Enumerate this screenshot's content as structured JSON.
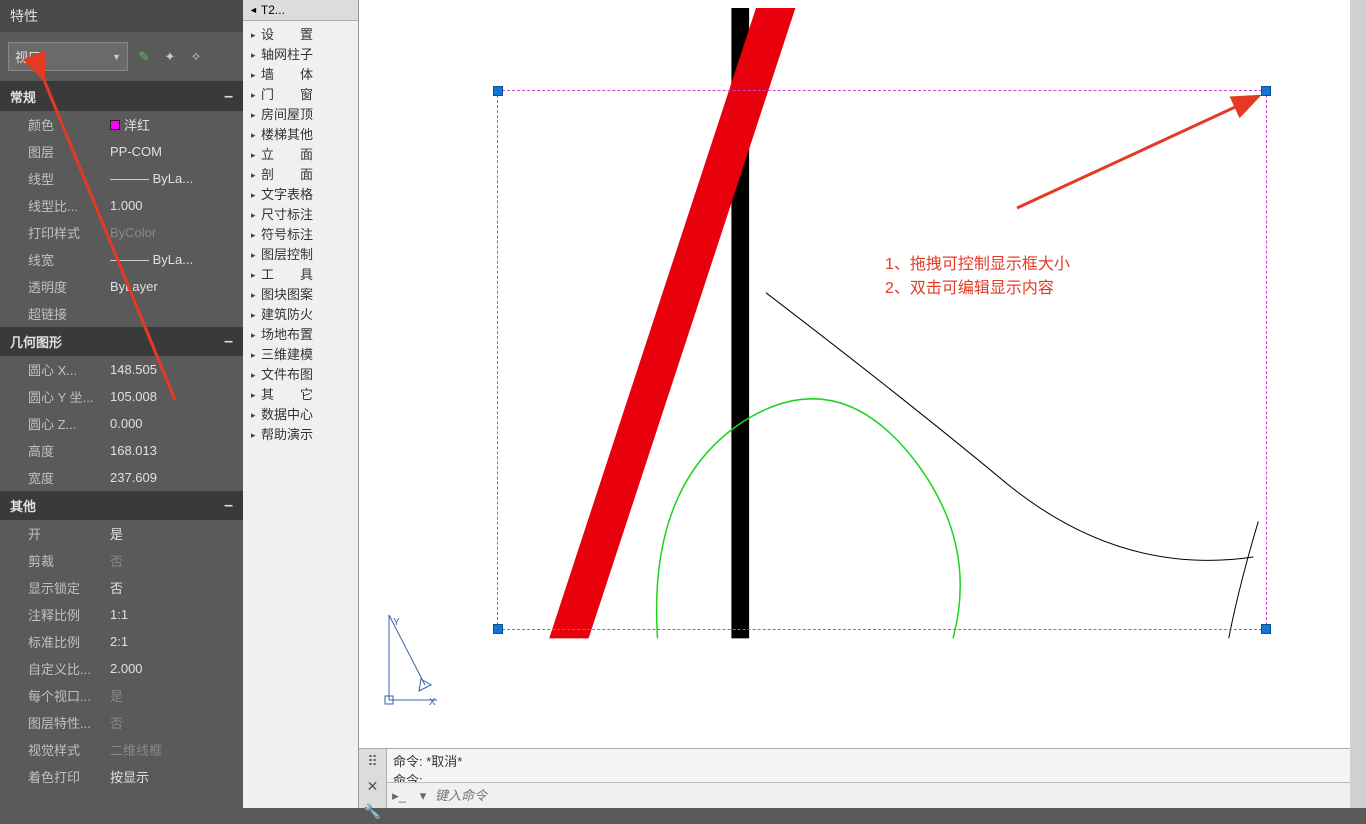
{
  "panel": {
    "title": "特性",
    "dropdown_value": "视口",
    "sections": {
      "general": {
        "title": "常规",
        "rows": {
          "color_label": "颜色",
          "color_value": "洋红",
          "layer_label": "图层",
          "layer_value": "PP-COM",
          "linetype_label": "线型",
          "linetype_value": "——— ByLa...",
          "ltscale_label": "线型比...",
          "ltscale_value": "1.000",
          "plotstyle_label": "打印样式",
          "plotstyle_value": "ByColor",
          "lineweight_label": "线宽",
          "lineweight_value": "——— ByLa...",
          "transparency_label": "透明度",
          "transparency_value": "ByLayer",
          "hyperlink_label": "超链接",
          "hyperlink_value": ""
        }
      },
      "geometry": {
        "title": "几何图形",
        "rows": {
          "cx_label": "圆心 X...",
          "cx_value": "148.505",
          "cy_label": "圆心 Y 坐...",
          "cy_value": "105.008",
          "cz_label": "圆心 Z...",
          "cz_value": "0.000",
          "h_label": "高度",
          "h_value": "168.013",
          "w_label": "宽度",
          "w_value": "237.609"
        }
      },
      "misc": {
        "title": "其他",
        "rows": {
          "on_label": "开",
          "on_value": "是",
          "clip_label": "剪裁",
          "clip_value": "否",
          "lock_label": "显示锁定",
          "lock_value": "否",
          "annoscale_label": "注释比例",
          "annoscale_value": "1:1",
          "stdscale_label": "标准比例",
          "stdscale_value": "2:1",
          "custom_label": "自定义比...",
          "custom_value": "2.000",
          "pervp_label": "每个视口...",
          "pervp_value": "是",
          "layerprop_label": "图层特性...",
          "layerprop_value": "否",
          "vstyle_label": "视觉样式",
          "vstyle_value": "二维线框",
          "shade_label": "着色打印",
          "shade_value": "按显示"
        }
      }
    }
  },
  "tree": {
    "tab": "T2...",
    "items": [
      "设　　置",
      "轴网柱子",
      "墙　　体",
      "门　　窗",
      "房间屋顶",
      "楼梯其他",
      "立　　面",
      "剖　　面",
      "文字表格",
      "尺寸标注",
      "符号标注",
      "图层控制",
      "工　　具",
      "图块图案",
      "建筑防火",
      "场地布置",
      "三维建模",
      "文件布图",
      "其　　它",
      "数据中心",
      "帮助演示"
    ]
  },
  "annotations": {
    "line1": "1、拖拽可控制显示框大小",
    "line2": "2、双击可编辑显示内容"
  },
  "command": {
    "history_prefix": "命令: ",
    "history_cmd": "*取消*",
    "prompt": "命令:",
    "placeholder": "键入命令"
  }
}
